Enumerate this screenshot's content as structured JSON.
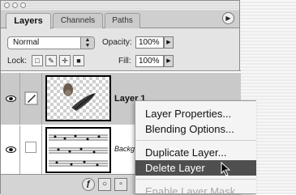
{
  "panel": {
    "tabs": [
      {
        "label": "Layers",
        "active": true
      },
      {
        "label": "Channels",
        "active": false
      },
      {
        "label": "Paths",
        "active": false
      }
    ],
    "blend_mode": "Normal",
    "opacity_label": "Opacity:",
    "opacity_value": "100%",
    "lock_label": "Lock:",
    "fill_label": "Fill:",
    "fill_value": "100%"
  },
  "layers": [
    {
      "name": "Layer 1",
      "visible": true,
      "selected": true
    },
    {
      "name": "Background",
      "visible": true,
      "selected": false
    }
  ],
  "context_menu": {
    "items": [
      {
        "label": "Layer Properties...",
        "state": "normal"
      },
      {
        "label": "Blending Options...",
        "state": "normal"
      },
      {
        "label": "Duplicate Layer...",
        "state": "normal"
      },
      {
        "label": "Delete Layer",
        "state": "highlighted"
      },
      {
        "label": "Enable Layer Mask",
        "state": "disabled"
      }
    ]
  },
  "icons": {
    "panel_menu": "panel-menu-arrow-icon",
    "stepper": "up-down-stepper-icon",
    "lock_transparency": "lock-transparency-icon",
    "lock_paint": "lock-paint-brush-icon",
    "lock_move": "lock-move-icon",
    "lock_all": "lock-all-padlock-icon",
    "cursor": "mouse-pointer-icon"
  },
  "colors": {
    "highlight": "#4f4f4f",
    "selected_row": "#c9c9c9"
  }
}
